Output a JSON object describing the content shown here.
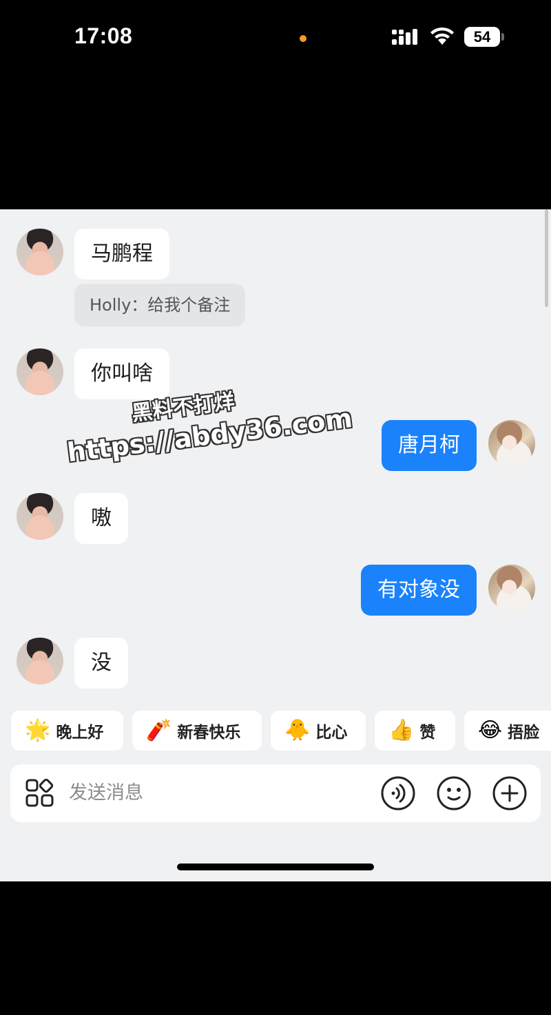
{
  "status_bar": {
    "time": "17:08",
    "battery": "54"
  },
  "messages": [
    {
      "side": "in",
      "text": "马鹏程"
    },
    {
      "side": "in",
      "text": "你叫啥"
    },
    {
      "side": "out",
      "text": "唐月柯"
    },
    {
      "side": "in",
      "text": "嗷"
    },
    {
      "side": "out",
      "text": "有对象没"
    },
    {
      "side": "in",
      "text": "没"
    }
  ],
  "note": "Holly：给我个备注",
  "watermark": {
    "line1": "黑料不打烊",
    "line2": "https://abdy36.com"
  },
  "quick_replies": [
    {
      "emoji": "🌟",
      "label": "晚上好"
    },
    {
      "emoji": "🧨",
      "label": "新春快乐"
    },
    {
      "emoji": "🐥",
      "label": "比心"
    },
    {
      "emoji": "👍",
      "label": "赞"
    },
    {
      "emoji": "😂",
      "label": "捂脸"
    }
  ],
  "input": {
    "placeholder": "发送消息"
  },
  "icons": {
    "apps": "apps-grid-icon",
    "voice": "voice-icon",
    "emoji": "emoji-icon",
    "plus": "plus-icon"
  },
  "colors": {
    "outgoing_bubble": "#1a82fb",
    "incoming_bubble": "#ffffff",
    "chat_background": "#f0f1f3"
  }
}
